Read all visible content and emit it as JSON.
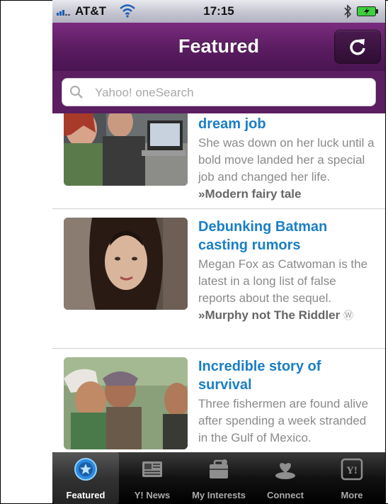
{
  "status_bar": {
    "carrier": "AT&T",
    "time": "17:15"
  },
  "navbar": {
    "title": "Featured",
    "refresh_icon": "refresh-icon"
  },
  "search": {
    "placeholder": "Yahoo! oneSearch"
  },
  "articles": [
    {
      "title": "dream job",
      "body": "She was down on her luck until a bold move landed her a special job and changed her life. ",
      "more": "»Modern fairy tale"
    },
    {
      "title": "Debunking Batman casting rumors",
      "body": "Megan Fox as Catwoman is the latest in a long list of false reports about the sequel. ",
      "more": "»Murphy not The Riddler",
      "source_badge": "Ⓦ"
    },
    {
      "title": "Incredible story of survival",
      "body": "Three fishermen are found alive after spending a week stranded in the Gulf of Mexico. "
    }
  ],
  "tabs": [
    {
      "label": "Featured",
      "icon": "star-icon",
      "active": true
    },
    {
      "label": "Y! News",
      "icon": "news-icon"
    },
    {
      "label": "My Interests",
      "icon": "briefcase-icon"
    },
    {
      "label": "Connect",
      "icon": "connect-icon"
    },
    {
      "label": "More",
      "icon": "yahoo-icon"
    }
  ],
  "colors": {
    "brand_purple": "#5a1c60",
    "link_blue": "#1a7fc4",
    "body_gray": "#8a8a8a"
  }
}
